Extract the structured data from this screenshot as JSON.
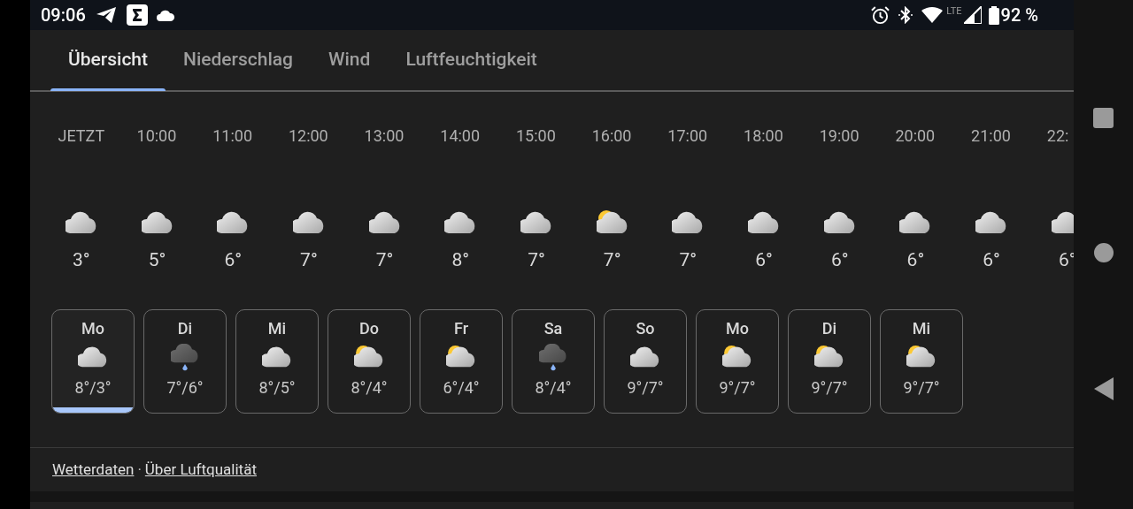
{
  "status_bar": {
    "time": "09:06",
    "network": "LTE",
    "battery": "92 %"
  },
  "tabs": [
    {
      "label": "Übersicht",
      "selected": true
    },
    {
      "label": "Niederschlag",
      "selected": false
    },
    {
      "label": "Wind",
      "selected": false
    },
    {
      "label": "Luftfeuchtigkeit",
      "selected": false
    }
  ],
  "hourly": [
    {
      "time": "JETZT",
      "kind": "cloudy",
      "temp": "3°"
    },
    {
      "time": "10:00",
      "kind": "cloudy",
      "temp": "5°"
    },
    {
      "time": "11:00",
      "kind": "cloudy",
      "temp": "6°"
    },
    {
      "time": "12:00",
      "kind": "cloudy",
      "temp": "7°"
    },
    {
      "time": "13:00",
      "kind": "cloudy",
      "temp": "7°"
    },
    {
      "time": "14:00",
      "kind": "cloudy",
      "temp": "8°"
    },
    {
      "time": "15:00",
      "kind": "cloudy",
      "temp": "7°"
    },
    {
      "time": "16:00",
      "kind": "partly_sunny",
      "temp": "7°"
    },
    {
      "time": "17:00",
      "kind": "cloudy",
      "temp": "7°"
    },
    {
      "time": "18:00",
      "kind": "cloudy",
      "temp": "6°"
    },
    {
      "time": "19:00",
      "kind": "cloudy",
      "temp": "6°"
    },
    {
      "time": "20:00",
      "kind": "cloudy",
      "temp": "6°"
    },
    {
      "time": "21:00",
      "kind": "cloudy",
      "temp": "6°"
    },
    {
      "time": "22:",
      "kind": "cloudy",
      "temp": "6°"
    }
  ],
  "daily": [
    {
      "day": "Mo",
      "kind": "cloudy",
      "temps": "8°/3°",
      "selected": true
    },
    {
      "day": "Di",
      "kind": "rain",
      "temps": "7°/6°",
      "selected": false
    },
    {
      "day": "Mi",
      "kind": "cloudy",
      "temps": "8°/5°",
      "selected": false
    },
    {
      "day": "Do",
      "kind": "partly_sunny",
      "temps": "8°/4°",
      "selected": false
    },
    {
      "day": "Fr",
      "kind": "partly_sunny",
      "temps": "6°/4°",
      "selected": false
    },
    {
      "day": "Sa",
      "kind": "rain",
      "temps": "8°/4°",
      "selected": false
    },
    {
      "day": "So",
      "kind": "cloudy",
      "temps": "9°/7°",
      "selected": false
    },
    {
      "day": "Mo",
      "kind": "partly_sunny",
      "temps": "9°/7°",
      "selected": false
    },
    {
      "day": "Di",
      "kind": "partly_sunny",
      "temps": "9°/7°",
      "selected": false
    },
    {
      "day": "Mi",
      "kind": "partly_sunny",
      "temps": "9°/7°",
      "selected": false
    }
  ],
  "footer_links": [
    {
      "label": "Wetterdaten"
    },
    {
      "label": "Über Luftqualität"
    }
  ],
  "footer_separator": "·"
}
